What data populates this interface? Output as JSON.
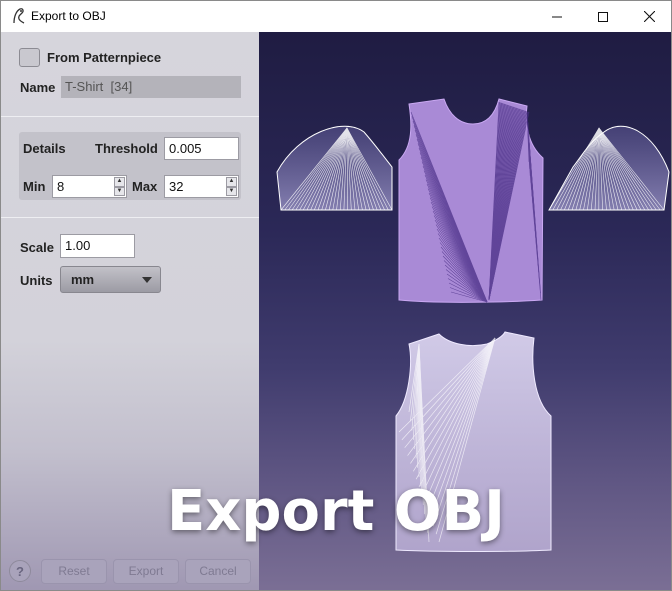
{
  "window": {
    "title": "Export to OBJ"
  },
  "panel": {
    "from_patternpiece_label": "From Patternpiece",
    "from_patternpiece_checked": false,
    "name_label": "Name",
    "name_value": "T-Shirt  [34]",
    "details_label": "Details",
    "threshold_label": "Threshold",
    "threshold_value": "0.005",
    "min_label": "Min",
    "min_value": "8",
    "max_label": "Max",
    "max_value": "32",
    "scale_label": "Scale",
    "scale_value": "1.00",
    "units_label": "Units",
    "units_value": "mm"
  },
  "buttons": {
    "help": "?",
    "reset": "Reset",
    "export": "Export",
    "cancel": "Cancel"
  },
  "overlay": {
    "title": "Export OBJ"
  },
  "colors": {
    "garment_front": "#a98ad6",
    "garment_lines": "#4a2f86",
    "garment_back": "#c9c0e4"
  }
}
